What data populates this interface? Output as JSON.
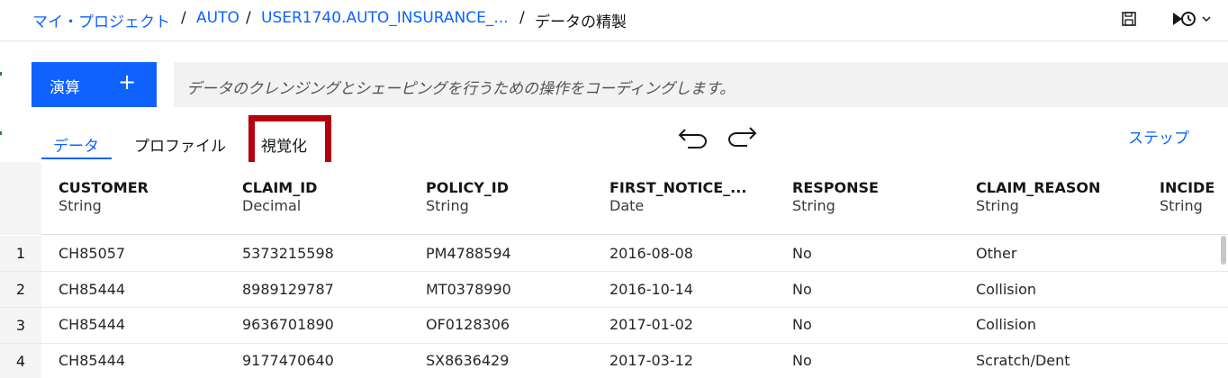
{
  "breadcrumb": {
    "items": [
      "マイ・プロジェクト",
      "AUTO",
      "USER1740.AUTO_INSURANCE_..."
    ],
    "separator": "/",
    "current": "データの精製"
  },
  "header": {
    "save_icon": "save-icon",
    "run_icon": "run-schedule-icon"
  },
  "toolbar": {
    "operation_label": "演算",
    "operation_plus": "+",
    "code_placeholder": "データのクレンジングとシェーピングを行うための操作をコーディングします。"
  },
  "tabs": [
    {
      "label": "データ",
      "active": true
    },
    {
      "label": "プロファイル",
      "active": false
    },
    {
      "label": "視覚化",
      "active": false,
      "highlighted": true
    }
  ],
  "steps_label": "ステップ",
  "colors": {
    "accent": "#0f62fe",
    "highlight": "#b5000f"
  },
  "table": {
    "columns": [
      {
        "name": "CUSTOMER",
        "type": "String"
      },
      {
        "name": "CLAIM_ID",
        "type": "Decimal"
      },
      {
        "name": "POLICY_ID",
        "type": "String"
      },
      {
        "name": "FIRST_NOTICE_...",
        "type": "Date"
      },
      {
        "name": "RESPONSE",
        "type": "String"
      },
      {
        "name": "CLAIM_REASON",
        "type": "String"
      },
      {
        "name": "INCIDE",
        "type": "String"
      }
    ],
    "rows": [
      {
        "num": "1",
        "cells": [
          "CH85057",
          "5373215598",
          "PM4788594",
          "2016-08-08",
          "No",
          "Other"
        ]
      },
      {
        "num": "2",
        "cells": [
          "CH85444",
          "8989129787",
          "MT0378990",
          "2016-10-14",
          "No",
          "Collision"
        ]
      },
      {
        "num": "3",
        "cells": [
          "CH85444",
          "9636701890",
          "OF0128306",
          "2017-01-02",
          "No",
          "Collision"
        ]
      },
      {
        "num": "4",
        "cells": [
          "CH85444",
          "9177470640",
          "SX8636429",
          "2017-03-12",
          "No",
          "Scratch/Dent"
        ]
      }
    ]
  }
}
